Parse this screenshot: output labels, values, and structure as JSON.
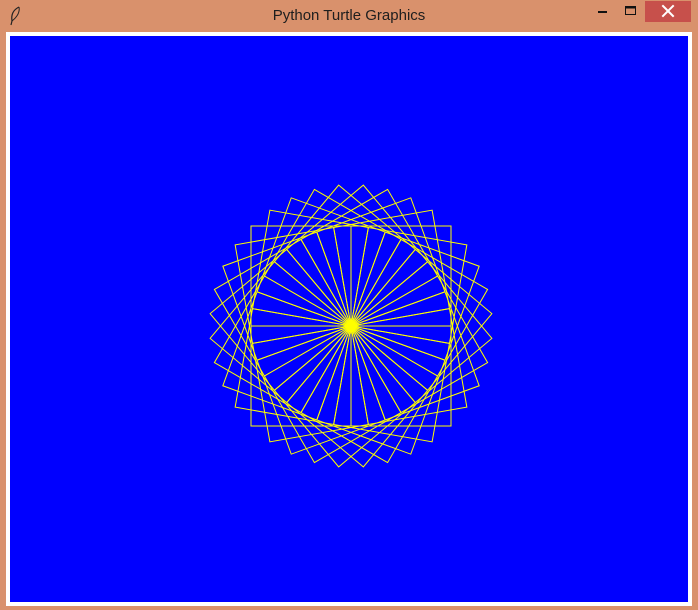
{
  "window": {
    "title": "Python Turtle Graphics",
    "icon": "feather-icon"
  },
  "controls": {
    "minimize_icon": "minimize-icon",
    "maximize_icon": "maximize-icon",
    "close_icon": "close-icon"
  },
  "canvas": {
    "background_color": "#0000ff",
    "pen_color": "#ffff00",
    "square_count": 36,
    "rotation_step_degrees": 10
  },
  "colors": {
    "titlebar": "#d9916c",
    "close_button": "#c7504b"
  }
}
